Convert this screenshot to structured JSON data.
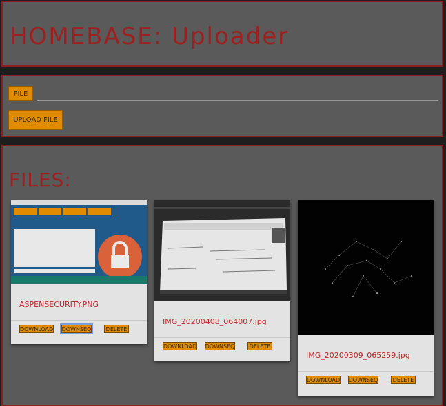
{
  "header": {
    "title": "HOMEBASE: Uploader"
  },
  "upload": {
    "file_label": "FILE",
    "upload_label": "UPLOAD FILE"
  },
  "files": {
    "heading": "FILES:",
    "items": [
      {
        "filename": "ASPENSECURITY.PNG",
        "download": "DOWNLOAD",
        "download_seq": "DOWNSEQ",
        "delete": "DELETE"
      },
      {
        "filename": "IMG_20200408_064007.jpg",
        "download": "DOWNLOAD",
        "download_seq": "DOWNSEQ",
        "delete": "DELETE"
      },
      {
        "filename": "IMG_20200309_065259.jpg",
        "download": "DOWNLOAD",
        "download_seq": "DOWNSEQ",
        "delete": "DELETE"
      }
    ]
  },
  "colors": {
    "accent": "#e08b00",
    "title": "#9c2020",
    "border": "#8b1f1f",
    "panel": "#5a5a5a",
    "background": "#1e1e1e"
  }
}
